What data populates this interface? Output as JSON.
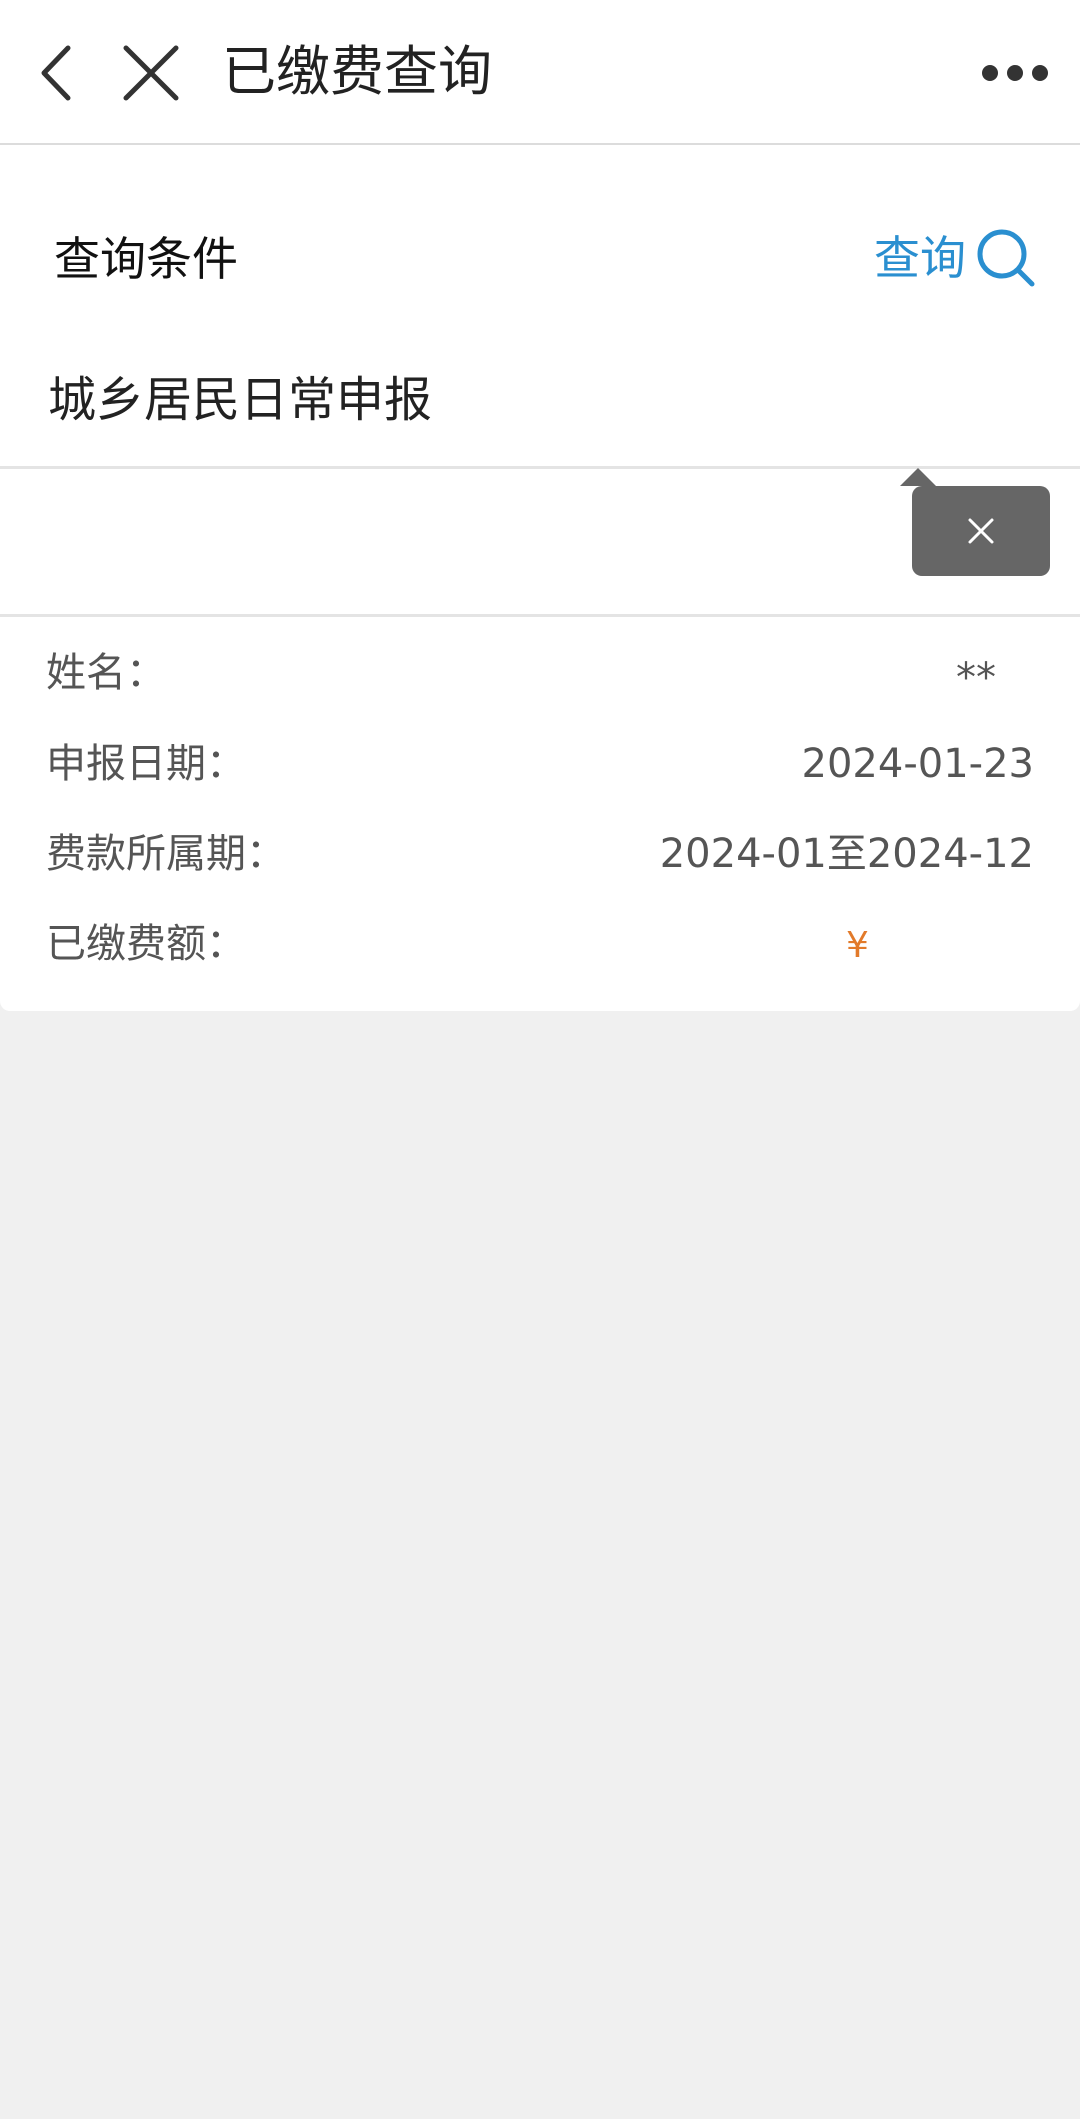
{
  "navbar": {
    "title": "已缴费查询",
    "icons": {
      "back": "chevron-left-icon",
      "close": "close-icon",
      "more": "more-horizontal-icon"
    }
  },
  "conditions": {
    "label": "查询条件",
    "query_label": "查询",
    "query_icon": "search-icon"
  },
  "report": {
    "type": "城乡居民日常申报"
  },
  "details": {
    "name_label": "姓名：",
    "name_value": "**",
    "date_label": "申报日期：",
    "date_value": "2024-01-23",
    "period_label": "费款所属期：",
    "period_value": "2024-01至2024-12",
    "paid_label": "已缴费额：",
    "paid_value": "¥"
  },
  "tooltip": {
    "close_icon": "close-icon"
  },
  "colors": {
    "accent": "#2a8fd0",
    "amount": "#e27a2a",
    "background": "#f0f0f0",
    "tooltip": "#666666"
  }
}
